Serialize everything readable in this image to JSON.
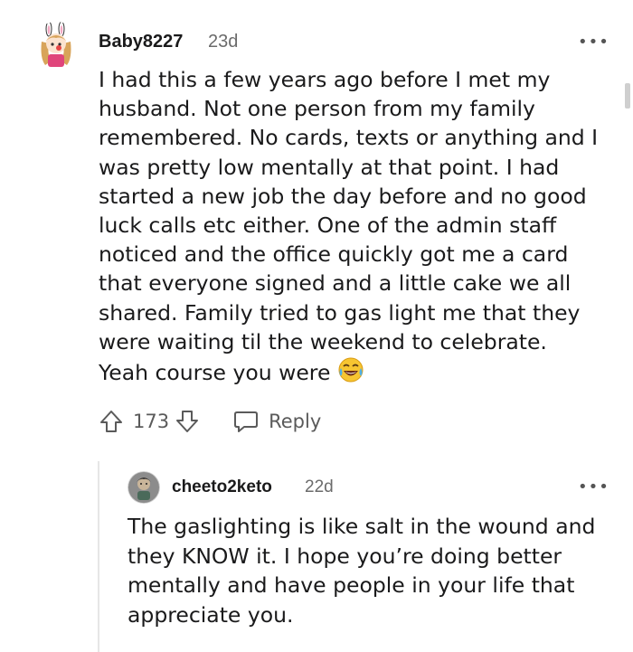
{
  "comments": [
    {
      "username": "Baby8227",
      "age": "23d",
      "more_label": "•••",
      "avatar_icon": "bunny-girl-avatar-icon",
      "body": "I had this a few years ago before I met my\nhusband. Not one person from my family\nremembered. No cards, texts or anything and I\nwas pretty low mentally at that point. I had\nstarted a new job the day before and no good\nluck calls etc either. One of the admin staff\nnoticed and the office quickly got me a card\nthat everyone signed and a little cake we all\nshared. Family tried to gas light me that they\nwere waiting til the weekend to celebrate.\nYeah course you were",
      "emoji": "tears-of-joy-emoji-icon",
      "score": "173",
      "reply_label": "Reply"
    },
    {
      "username": "cheeto2keto",
      "age": "22d",
      "more_label": "•••",
      "avatar_icon": "character-avatar-icon",
      "body": "The gaslighting is like salt in the wound and\nthey KNOW it. I hope you’re doing better\nmentally and have people in your life that\nappreciate you."
    }
  ],
  "colors": {
    "text": "#1a1a1b",
    "muted": "#6b6b6b",
    "thread_line": "#e6e6e6",
    "accent_pink": "#e0457b"
  }
}
